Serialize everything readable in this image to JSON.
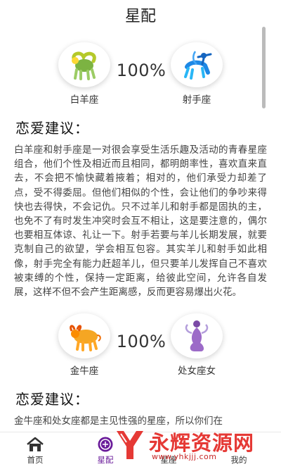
{
  "header": {
    "title": "星配"
  },
  "pairs": [
    {
      "left": {
        "name": "白羊座",
        "icon": "aries-ram-icon",
        "color": "#8bc34a"
      },
      "right": {
        "name": "射手座",
        "icon": "sagittarius-archer-icon",
        "color": "#1e88e5"
      },
      "percent": "100%",
      "advice_title": "恋爱建议：",
      "advice": "白羊座和射手座是一对很会享受生活乐趣及活动的青春星座组合，他们个性及相近而且相同，都明朗率性，喜欢直来直去，不会把不愉快藏着掖着；相对的，他们承受力却差了点，受不得委屈。但他们相似的个性，会让他们的争吵来得快也去得快，不会记仇。只不过羊儿和射手都是固执的主，也免不了有时发生冲突时会互不相让，这是要注意的，偶尔也要相互体谅、礼让一下。射手若要与羊儿长期发展，就要克制自己的欲望，学会相互包容。其实羊儿和射手如此相像，射手完全有能力赶超羊儿，但只要羊儿发挥自己不喜欢被束缚的个性，保持一定距离，给彼此空间，允许各自发展，这样不但不会产生距离感，反而更容易爆出火花。"
    },
    {
      "left": {
        "name": "金牛座",
        "icon": "taurus-bull-icon",
        "color": "#f5a623"
      },
      "right": {
        "name": "处女座女",
        "icon": "virgo-maiden-icon",
        "color": "#8e5bb5"
      },
      "percent": "100%",
      "advice_title": "恋爱建议：",
      "advice": "金牛座和处女座都是主见性强的星座，所以你们在"
    }
  ],
  "tabbar": {
    "items": [
      {
        "label": "首页",
        "icon": "home-icon",
        "active": false
      },
      {
        "label": "星配",
        "icon": "constellation-icon",
        "active": true
      },
      {
        "label": "星座",
        "icon": "",
        "active": false
      },
      {
        "label": "我的",
        "icon": "",
        "active": false
      }
    ],
    "active_color": "#6a1b9a"
  },
  "watermark": {
    "title": "永辉资源网",
    "url": "www.yhkjjj.com",
    "color": "#e53935"
  }
}
